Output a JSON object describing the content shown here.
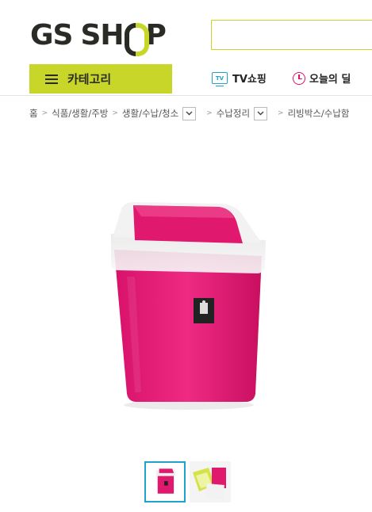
{
  "header": {
    "logo_left": "GS",
    "logo_sh": "SH",
    "logo_p": "P",
    "search": {
      "value": "",
      "placeholder": ""
    }
  },
  "nav": {
    "category_label": "카테고리",
    "tv_icon_text": "TV",
    "tv_label": "TV쇼핑",
    "deal_label": "오늘의 딜"
  },
  "breadcrumb": {
    "items": [
      "홈",
      "식품/생활/주방",
      "생활/수납/청소",
      "수납정리",
      "리빙박스/수납함"
    ]
  },
  "product": {
    "color_primary": "#e0196f",
    "color_lid": "#f0f0f0"
  },
  "thumbnails": {
    "count": 2,
    "active_index": 0
  },
  "colors": {
    "brand_green": "#c8d62a",
    "accent_blue": "#1fa3c9",
    "accent_pink": "#e0116d"
  }
}
